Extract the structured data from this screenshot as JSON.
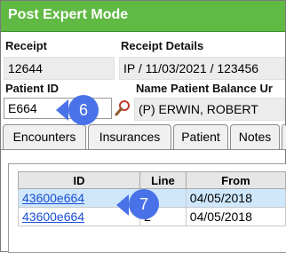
{
  "window": {
    "title": "Post Expert Mode"
  },
  "receipt": {
    "label": "Receipt",
    "value": "12644"
  },
  "receipt_details": {
    "label": "Receipt Details",
    "value": "IP / 11/03/2021 / 123456"
  },
  "patient_id": {
    "label": "Patient ID",
    "value": "E664"
  },
  "name_header": {
    "label": "Name Patient Balance Ur"
  },
  "patient_name": {
    "value": "(P) ERWIN, ROBERT"
  },
  "tabs": [
    {
      "label": "Encounters"
    },
    {
      "label": "Insurances"
    },
    {
      "label": "Patient"
    },
    {
      "label": "Notes"
    }
  ],
  "grid": {
    "columns": [
      "ID",
      "Line",
      "From"
    ],
    "rows": [
      {
        "id": "43600e664",
        "line": "1",
        "from": "04/05/2018"
      },
      {
        "id": "43600e664",
        "line": "2",
        "from": "04/05/2018"
      }
    ]
  },
  "callouts": [
    {
      "number": "6"
    },
    {
      "number": "7"
    }
  ],
  "colors": {
    "titlebar": "#5fb943",
    "callout": "#4a72e8",
    "selected_row": "#cfe7fb",
    "link": "#1a4fd4"
  },
  "icons": {
    "search": "magnifier-icon"
  }
}
